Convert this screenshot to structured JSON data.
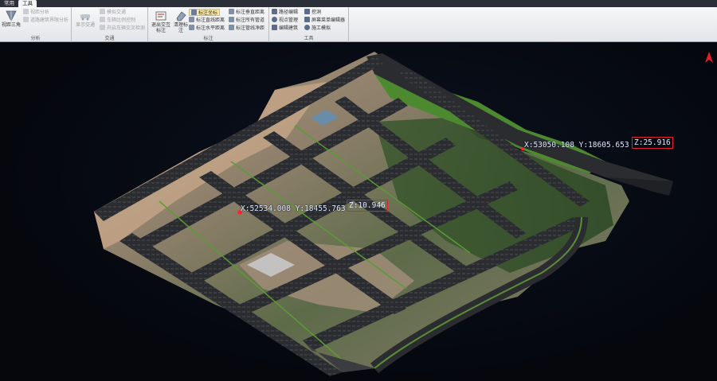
{
  "tabs": [
    {
      "label": "常用",
      "active": false
    },
    {
      "label": "工具",
      "active": true
    }
  ],
  "ribbon": {
    "analysis": {
      "title": "分析",
      "big_label": "视距三角",
      "items": [
        "视距分析",
        "道路建筑界限分析"
      ]
    },
    "traffic": {
      "title": "交通",
      "big_label": "显示交通",
      "items": [
        "模拟交通",
        "车辆比例控制",
        "开启车辆交叉检测"
      ]
    },
    "annotate": {
      "title": "标注",
      "big_labels": [
        "退出交互标注",
        "清理标注"
      ],
      "col1": [
        "标注坐标",
        "标注直线距离",
        "标注水平距离"
      ],
      "col2": [
        "标注垂直距离",
        "标注所有管道",
        "标注管线净距"
      ]
    },
    "tools": {
      "title": "工具",
      "col1": [
        "路径编辑",
        "视点管理",
        "编辑建筑"
      ],
      "col2": [
        "挖洞",
        "屏幕菜单编辑器",
        "施工模拟"
      ]
    }
  },
  "colors": {
    "ribbon_bg": "#e7e9ed",
    "highlight": "#fde9a2",
    "marker": "#ff2630",
    "label_box": "#e0202a",
    "label_text": "#dfe8ff",
    "greenbelt": "#4d8a2f",
    "road": "#2a2c30"
  },
  "labels": {
    "point1": {
      "xy": "X:52534.008 Y:18455.763 ",
      "z": "Z:10.946"
    },
    "point2": {
      "xy": "X:53050.108 Y:18605.653 ",
      "z": "Z:25.916"
    }
  },
  "icons": {
    "north": "north-arrow-icon"
  }
}
